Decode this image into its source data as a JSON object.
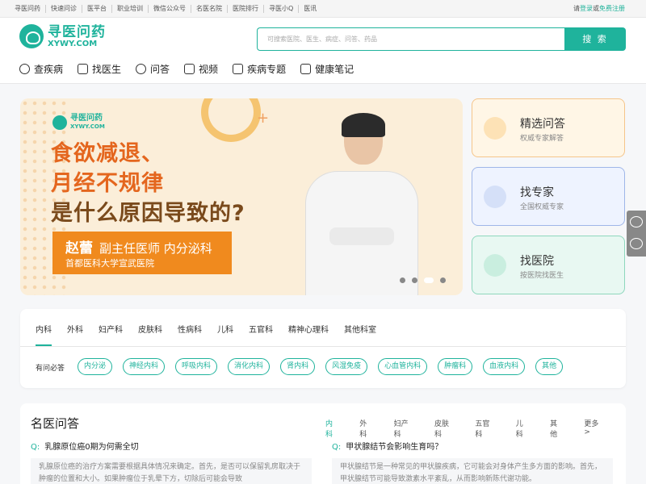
{
  "topbar": {
    "links": [
      "寻医问药",
      "快速问诊",
      "医平台",
      "职业培训",
      "微信公众号",
      "名医名院",
      "医院排行",
      "寻医小Q",
      "医讯"
    ],
    "login_prefix": "请",
    "login": "登录",
    "or": "或",
    "register": "免费注册"
  },
  "logo": {
    "cn": "寻医问药",
    "en": "XYWY.COM"
  },
  "search": {
    "placeholder": "可搜索医院、医生、病症、问答、药品",
    "button": "搜 索"
  },
  "nav": [
    "查疾病",
    "找医生",
    "问答",
    "视频",
    "疾病专题",
    "健康笔记"
  ],
  "banner": {
    "logo_cn": "寻医问药",
    "logo_en": "XYWY.COM",
    "line1": "食欲减退、",
    "line2": "月经不规律",
    "line3": "是什么原因导致的?",
    "doctor_name": "赵蕾",
    "doctor_title": "副主任医师",
    "doctor_dept": "内分泌科",
    "hospital": "首都医科大学宣武医院"
  },
  "cards": [
    {
      "title": "精选问答",
      "sub": "权威专家解答"
    },
    {
      "title": "找专家",
      "sub": "全国权威专家"
    },
    {
      "title": "找医院",
      "sub": "按医院找医生"
    }
  ],
  "departments": {
    "tabs": [
      "内科",
      "外科",
      "妇产科",
      "皮肤科",
      "性病科",
      "儿科",
      "五官科",
      "精神心理科",
      "其他科室"
    ],
    "label": "有问必答",
    "tags": [
      "内分泌",
      "神经内科",
      "呼吸内科",
      "消化内科",
      "肾内科",
      "风湿免疫",
      "心血管内科",
      "肿瘤科",
      "血液内科",
      "其他"
    ]
  },
  "qa": {
    "title": "名医问答",
    "tabs": [
      "内科",
      "外科",
      "妇产科",
      "皮肤科",
      "五官科",
      "儿科",
      "其他",
      "更多 >"
    ],
    "q1": "乳腺原位癌0期为何需全切",
    "a1": "乳腺原位癌的治疗方案需要根据具体情况来确定。首先，是否可以保留乳房取决于肿瘤的位置和大小。如果肿瘤位于乳晕下方，切除后可能会导致",
    "q2": "甲状腺结节会影响生育吗？",
    "a2": "甲状腺结节是一种常见的甲状腺疾病，它可能会对身体产生多方面的影响。首先，甲状腺结节可能导致激素水平紊乱，从而影响新陈代谢功能。"
  }
}
